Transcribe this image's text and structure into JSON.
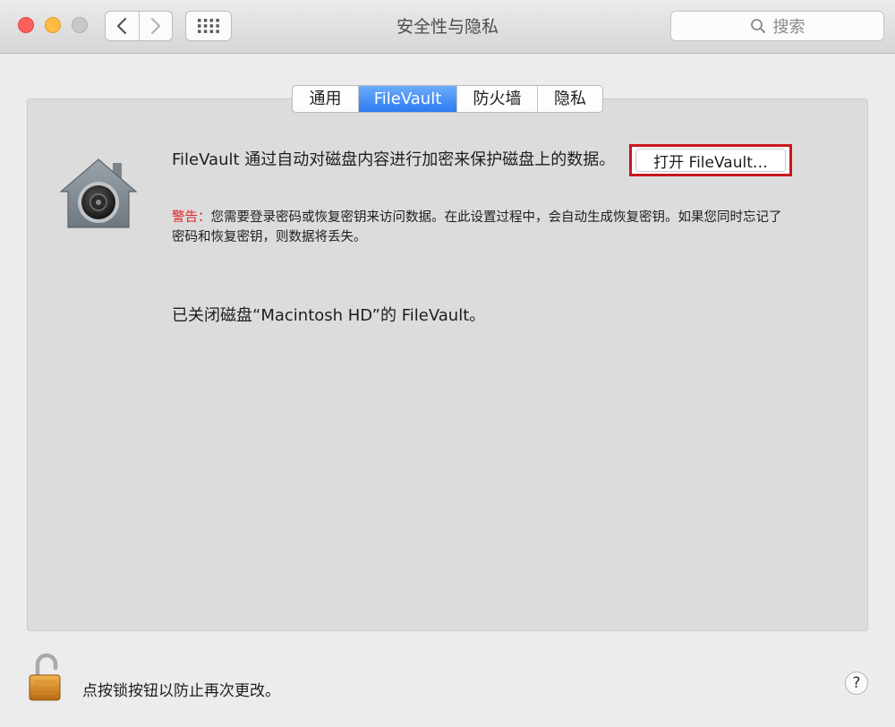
{
  "window": {
    "title": "安全性与隐私"
  },
  "toolbar": {
    "back_icon": "chevron-left-icon",
    "forward_icon": "chevron-right-icon",
    "grid_icon": "grid-icon",
    "search_placeholder": "搜索"
  },
  "tabs": [
    {
      "label": "通用",
      "active": false
    },
    {
      "label": "FileVault",
      "active": true
    },
    {
      "label": "防火墙",
      "active": false
    },
    {
      "label": "隐私",
      "active": false
    }
  ],
  "filevault": {
    "description": "FileVault 通过自动对磁盘内容进行加密来保护磁盘上的数据。",
    "warning_label": "警告：",
    "warning_text": "您需要登录密码或恢复密钥来访问数据。在此设置过程中，会自动生成恢复密钥。如果您同时忘记了密码和恢复密钥，则数据将丢失。",
    "turn_on_button": "打开 FileVault…",
    "status": "已关闭磁盘“Macintosh HD”的 FileVault。"
  },
  "footer": {
    "lock_text": "点按锁按钮以防止再次更改。",
    "help_label": "?"
  },
  "colors": {
    "accent": "#2f7cf2",
    "warning": "#e0232b",
    "highlight_border": "#c9171c"
  }
}
